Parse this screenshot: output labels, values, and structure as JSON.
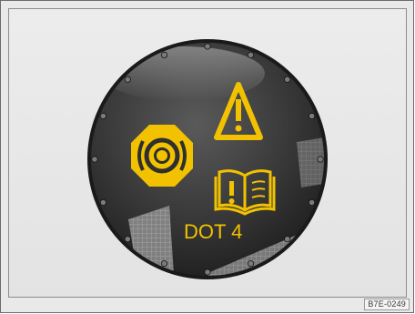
{
  "cap": {
    "fluid_label": "DOT 4",
    "symbols": [
      "brake-warning-icon",
      "warning-triangle-icon",
      "manual-info-icon"
    ],
    "cap_color": "#2b2b2b",
    "symbol_color": "#f2c200"
  },
  "caption_code": "B7E-0249"
}
